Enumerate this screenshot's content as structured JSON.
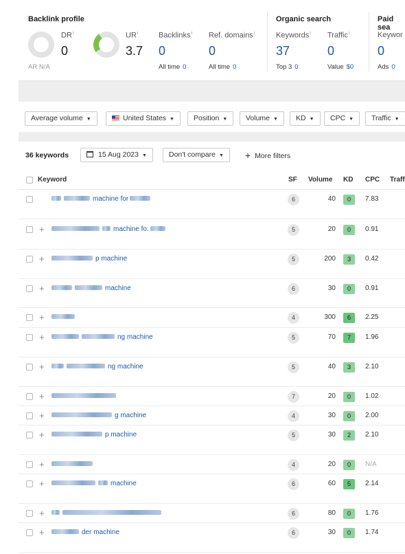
{
  "backlink": {
    "title": "Backlink profile",
    "dr_label": "DR",
    "dr_value": "0",
    "ur_label": "UR",
    "ur_value": "3.7",
    "backlinks_label": "Backlinks",
    "backlinks_value": "0",
    "backlinks_sub_label": "All time",
    "backlinks_sub_value": "0",
    "refdomains_label": "Ref. domains",
    "refdomains_value": "0",
    "refdomains_sub_label": "All time",
    "refdomains_sub_value": "0",
    "ar_label": "AR",
    "ar_value": "N/A",
    "info_mark": "i"
  },
  "organic": {
    "title": "Organic search",
    "keywords_label": "Keywords",
    "keywords_value": "37",
    "keywords_sub_label": "Top 3",
    "keywords_sub_value": "0",
    "traffic_label": "Traffic",
    "traffic_value": "0",
    "traffic_sub_label": "Value",
    "traffic_sub_value": "$0"
  },
  "paid": {
    "title": "Paid sea",
    "keywords_label": "Keywor",
    "keywords_value": "0",
    "ads_label": "Ads",
    "ads_value": "0"
  },
  "filters": {
    "average_volume": "Average volume",
    "country": "United States",
    "position": "Position",
    "volume": "Volume",
    "kd": "KD",
    "cpc": "CPC",
    "traffic": "Traffic"
  },
  "toolbar": {
    "count": "36 keywords",
    "date": "15 Aug 2023",
    "compare": "Don't compare",
    "more_filters": "More filters"
  },
  "table": {
    "headers": {
      "keyword": "Keyword",
      "sf": "SF",
      "volume": "Volume",
      "kd": "KD",
      "cpc": "CPC",
      "traffic": "Traff"
    },
    "rows": [
      {
        "blur1": 14,
        "blur2": 38,
        "text": "machine for",
        "blur3": 30,
        "sf": "6",
        "volume": "40",
        "kd": "0",
        "cpc": "7.83",
        "plus": false
      },
      {
        "blur1": 70,
        "blur2": 12,
        "text": "machine fo.",
        "blur3": 22,
        "sf": "5",
        "volume": "20",
        "kd": "0",
        "cpc": "0.91",
        "plus": true
      },
      {
        "blur1": 60,
        "blur2": 0,
        "text": "p machine",
        "blur3": 0,
        "sf": "5",
        "volume": "200",
        "kd": "3",
        "cpc": "0.42",
        "plus": true
      },
      {
        "blur1": 30,
        "blur2": 40,
        "text": "machine",
        "blur3": 0,
        "sf": "6",
        "volume": "30",
        "kd": "0",
        "cpc": "0.91",
        "plus": true
      },
      {
        "blur1": 34,
        "blur2": 0,
        "text": "",
        "blur3": 0,
        "sf": "4",
        "volume": "300",
        "kd": "6",
        "cpc": "2.25",
        "plus": true
      },
      {
        "blur1": 40,
        "blur2": 48,
        "text": "ng machine",
        "blur3": 0,
        "sf": "5",
        "volume": "70",
        "kd": "7",
        "cpc": "1.96",
        "plus": true
      },
      {
        "blur1": 18,
        "blur2": 56,
        "text": "ng machine",
        "blur3": 0,
        "sf": "5",
        "volume": "40",
        "kd": "3",
        "cpc": "2.10",
        "plus": true
      },
      {
        "blur1": 94,
        "blur2": 0,
        "text": "",
        "blur3": 0,
        "sf": "7",
        "volume": "20",
        "kd": "0",
        "cpc": "1.02",
        "plus": true
      },
      {
        "blur1": 88,
        "blur2": 0,
        "text": "g machine",
        "blur3": 0,
        "sf": "4",
        "volume": "30",
        "kd": "0",
        "cpc": "2.00",
        "plus": true
      },
      {
        "blur1": 74,
        "blur2": 0,
        "text": "p machine",
        "blur3": 0,
        "sf": "5",
        "volume": "30",
        "kd": "2",
        "cpc": "2.10",
        "plus": true
      },
      {
        "blur1": 60,
        "blur2": 0,
        "text": "",
        "blur3": 0,
        "sf": "4",
        "volume": "20",
        "kd": "0",
        "cpc": "N/A",
        "plus": true
      },
      {
        "blur1": 64,
        "blur2": 14,
        "text": "machine",
        "blur3": 0,
        "sf": "6",
        "volume": "60",
        "kd": "5",
        "cpc": "2.14",
        "plus": true
      },
      {
        "blur1": 12,
        "blur2": 144,
        "text": "",
        "blur3": 0,
        "sf": "6",
        "volume": "80",
        "kd": "0",
        "cpc": "1.76",
        "plus": true
      },
      {
        "blur1": 40,
        "blur2": 0,
        "text": "der machine",
        "blur3": 0,
        "sf": "6",
        "volume": "30",
        "kd": "0",
        "cpc": "1.74",
        "plus": true
      }
    ]
  },
  "colors": {
    "link": "#1a5ba6",
    "kd_low": "#8fd29c",
    "kd_mid": "#67c47b",
    "ur_accent": "#7cc04b"
  }
}
